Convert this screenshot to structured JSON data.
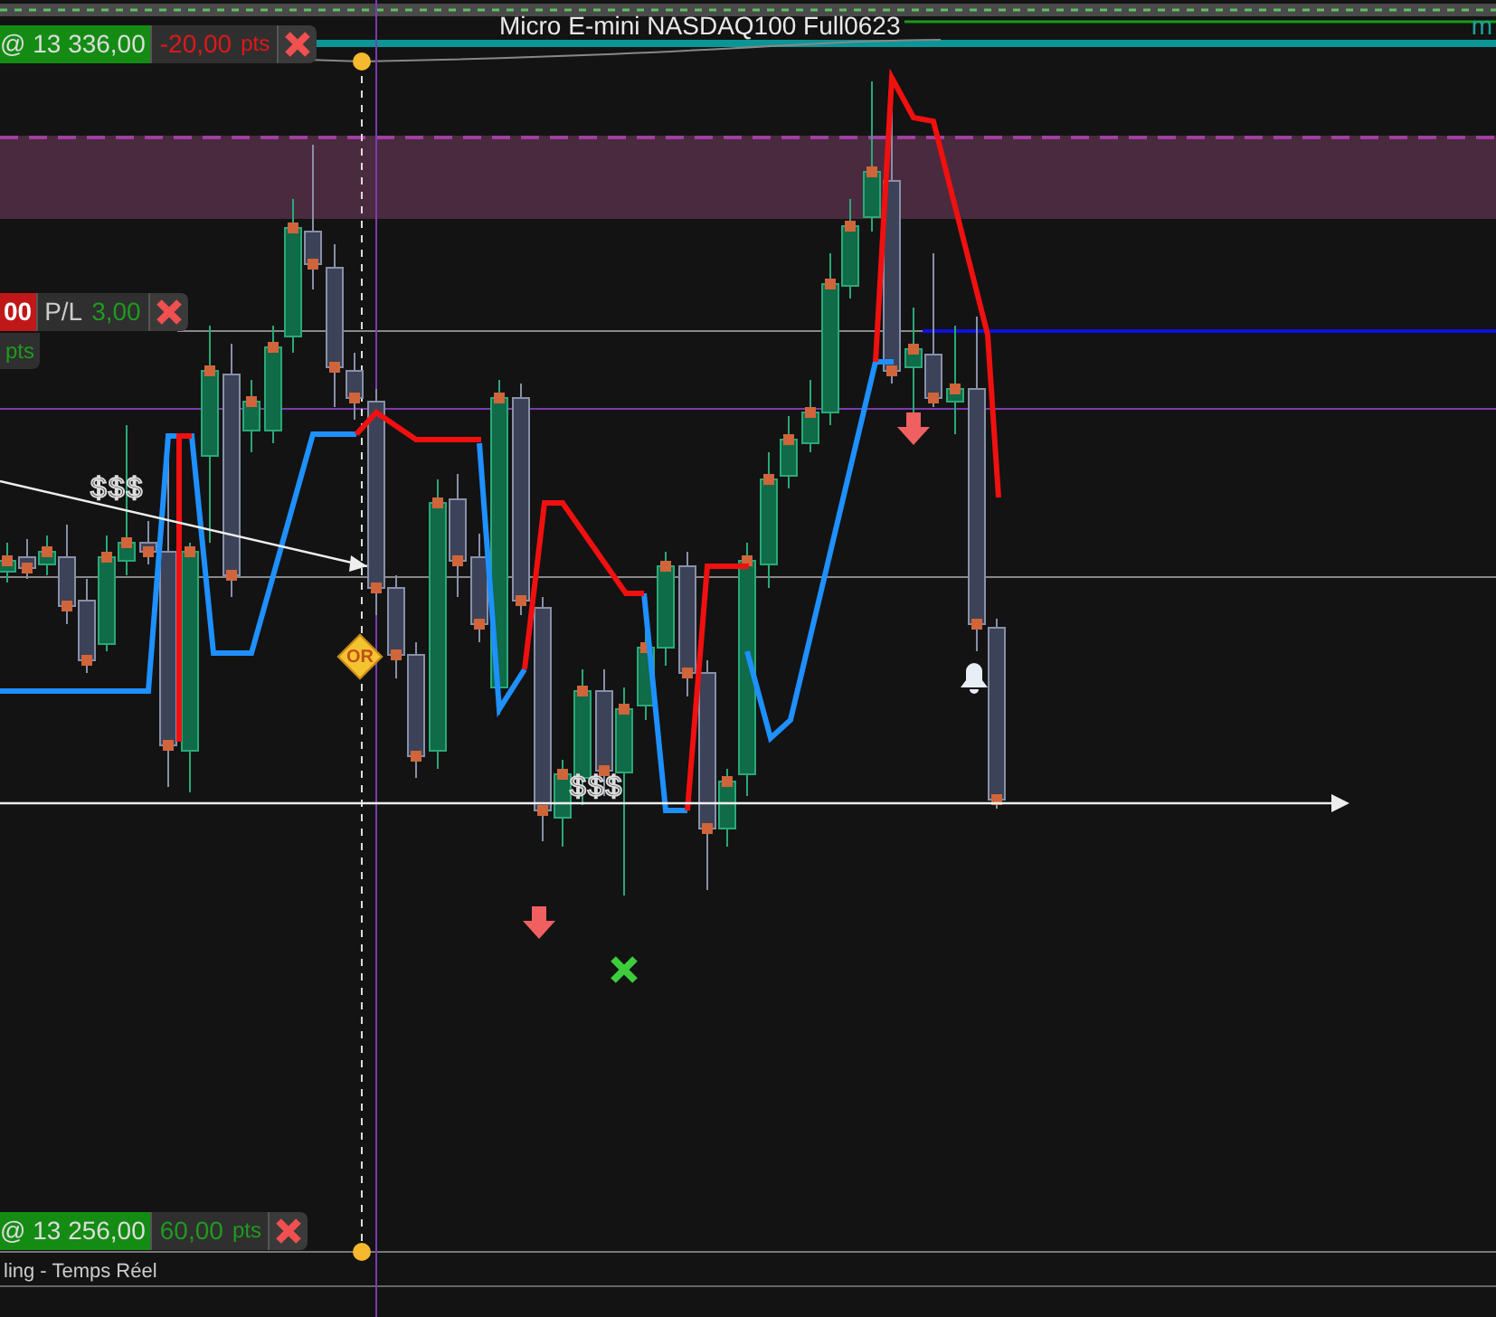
{
  "chart": {
    "title": "Micro E-mini NASDAQ100 Full0623",
    "right_edge_label": "m"
  },
  "orders": [
    {
      "kind": "target",
      "price": "@ 13 336,00",
      "pl": "-20,00",
      "unit": "pts",
      "profit": false
    },
    {
      "kind": "stop",
      "price": "@ 13 256,00",
      "pl": "60,00",
      "unit": "pts",
      "profit": true
    }
  ],
  "position": {
    "qty": "00",
    "label": "P/L",
    "value": "3,00",
    "unit": "pts",
    "profit": true
  },
  "annotations": [
    {
      "kind": "text",
      "text": "$$$"
    },
    {
      "kind": "text",
      "text": "$$$"
    },
    {
      "kind": "diamond",
      "text": "OR"
    }
  ],
  "status_bar": {
    "text": "ling - Temps Réel"
  }
}
